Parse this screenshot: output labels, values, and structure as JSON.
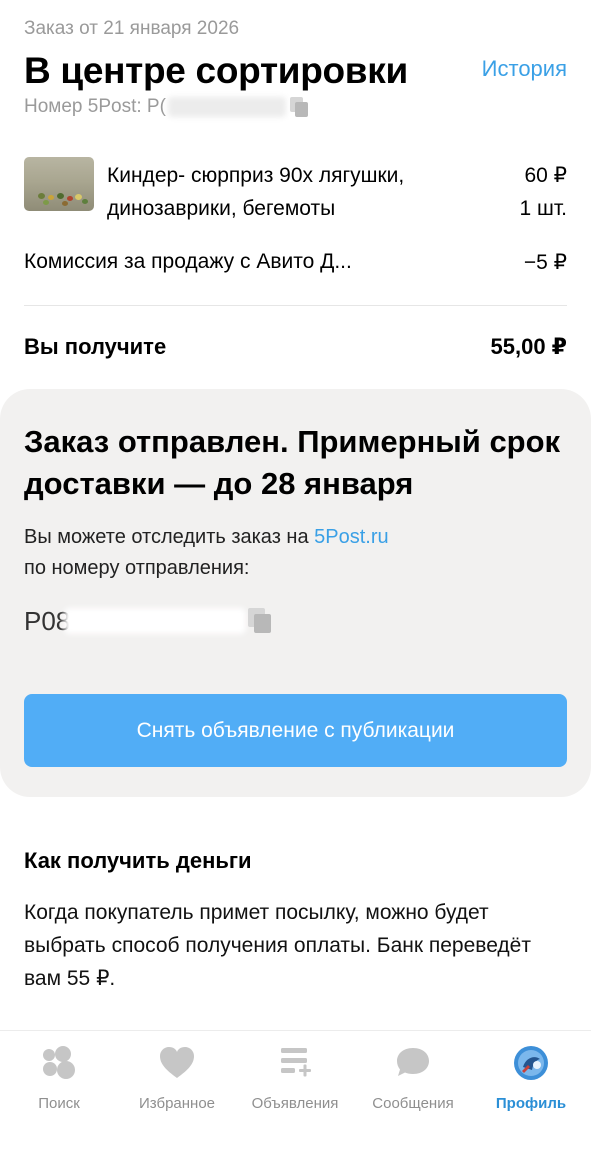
{
  "header": {
    "order_date": "Заказ от 21 января 2026",
    "status_title": "В центре сортировки",
    "history_link": "История",
    "tracking_label": "Номер 5Post: Р("
  },
  "item": {
    "title": "Киндер- сюрприз 90х лягушки, динозаврики, бегемоты",
    "price": "60 ₽",
    "quantity": "1 шт."
  },
  "fee": {
    "label": "Комиссия за продажу с Авито Д...",
    "value": "−5 ₽"
  },
  "total": {
    "label": "Вы получите",
    "value": "55,00 ₽"
  },
  "shipment_card": {
    "title": "Заказ отправлен. Примерный срок доставки — до 28 января",
    "text_before_link": "Вы можете отследить заказ на ",
    "link_text": "5Post.ru",
    "text_after_link": "по номеру отправления:",
    "tracking_number_visible": "Р08",
    "button_label": "Снять объявление с публикации"
  },
  "payout_info": {
    "title": "Как получить деньги",
    "text": "Когда покупатель примет посылку, можно будет выбрать способ получения оплаты. Банк переведёт вам 55 ₽."
  },
  "tabbar": {
    "tabs": [
      {
        "label": "Поиск",
        "icon": "search-bubbles-icon",
        "active": false
      },
      {
        "label": "Избранное",
        "icon": "heart-icon",
        "active": false
      },
      {
        "label": "Объявления",
        "icon": "listings-add-icon",
        "active": false
      },
      {
        "label": "Сообщения",
        "icon": "chat-bubble-icon",
        "active": false
      },
      {
        "label": "Профиль",
        "icon": "profile-avatar-icon",
        "active": true
      }
    ]
  },
  "colors": {
    "accent": "#3aa0e6",
    "button": "#51adf6",
    "card_background": "#f2f1f0",
    "secondary_text": "#9a9a9a"
  }
}
